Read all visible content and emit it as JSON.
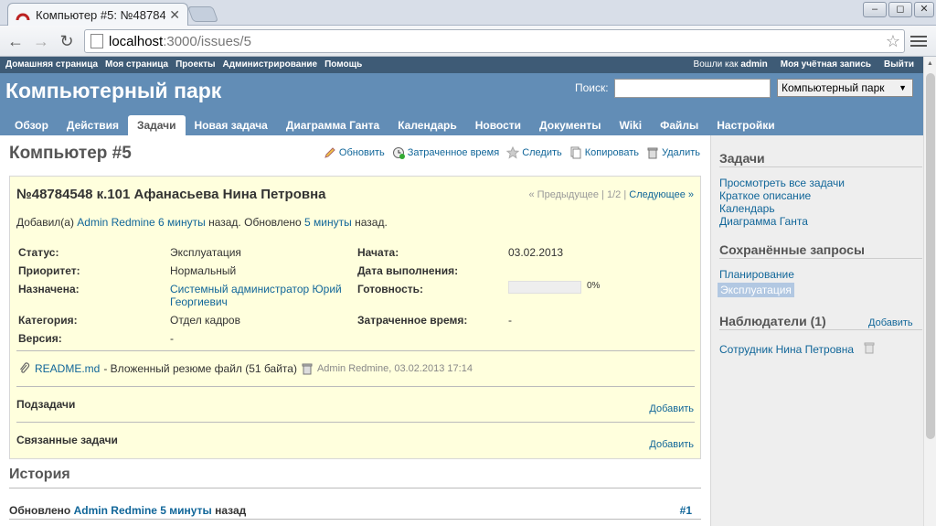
{
  "browser": {
    "tab_title": "Компьютер #5: №48784",
    "url_host": "localhost",
    "url_path": ":3000/issues/5",
    "win_min": "–",
    "win_max": "◻",
    "win_close": "✕"
  },
  "topmenu": {
    "items": [
      "Домашняя страница",
      "Моя страница",
      "Проекты",
      "Администрирование",
      "Помощь"
    ],
    "logged_as": "Вошли как",
    "user": "admin",
    "account": "Моя учётная запись",
    "logout": "Выйти"
  },
  "header": {
    "project": "Компьютерный парк",
    "search_label": "Поиск:",
    "project_select": "Компьютерный парк"
  },
  "mainmenu": [
    "Обзор",
    "Действия",
    "Задачи",
    "Новая задача",
    "Диаграмма Ганта",
    "Календарь",
    "Новости",
    "Документы",
    "Wiki",
    "Файлы",
    "Настройки"
  ],
  "issue": {
    "title": "Компьютер #5",
    "actions": [
      "Обновить",
      "Затраченное время",
      "Следить",
      "Копировать",
      "Удалить"
    ],
    "subject": "№48784548 к.101 Афанасьева Нина Петровна",
    "prev": "« Предыдущее",
    "pos": "1/2",
    "next": "Следующее »",
    "added_by": "Добавил(а)",
    "author": "Admin Redmine",
    "added_ago": "6 минуты",
    "ago_word": "назад.",
    "updated": "Обновлено",
    "updated_ago": "5 минуты",
    "status_l": "Статус:",
    "status": "Эксплуатация",
    "priority_l": "Приоритет:",
    "priority": "Нормальный",
    "assigned_l": "Назначена:",
    "assigned_1": "Системный администратор Юрий",
    "assigned_2": "Георгиевич",
    "category_l": "Категория:",
    "category": "Отдел кадров",
    "version_l": "Версия:",
    "version": "-",
    "start_l": "Начата:",
    "start": "03.02.2013",
    "due_l": "Дата выполнения:",
    "done_l": "Готовность:",
    "done": "0%",
    "spent_l": "Затраченное время:",
    "spent": "-",
    "done_ratio": 0,
    "file": "README.md",
    "file_desc": "- Вложенный резюме файл (51 байта)",
    "file_meta": "Admin Redmine, 03.02.2013 17:14",
    "subtasks": "Подзадачи",
    "related": "Связанные задачи",
    "add": "Добавить"
  },
  "history": {
    "title": "История",
    "updated": "Обновлено",
    "author": "Admin Redmine",
    "ago": "5 минуты",
    "ago_word": "назад",
    "num": "#1"
  },
  "sidebar": {
    "tasks_h": "Задачи",
    "links": [
      "Просмотреть все задачи",
      "Краткое описание",
      "Календарь",
      "Диаграмма Ганта"
    ],
    "saved_h": "Сохранённые запросы",
    "queries": [
      "Планирование",
      "Эксплуатация"
    ],
    "watchers_h": "Наблюдатели (1)",
    "add": "Добавить",
    "watcher": "Сотрудник Нина Петровна"
  }
}
